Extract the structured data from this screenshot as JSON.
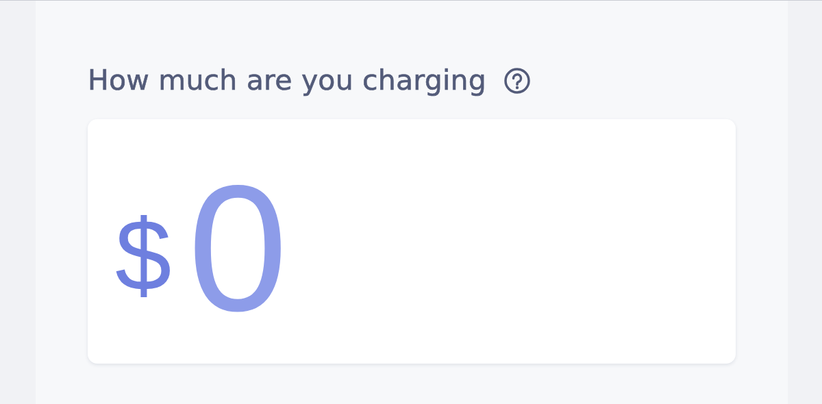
{
  "question": {
    "label": "How much are you charging"
  },
  "amount": {
    "currency": "$",
    "placeholder": "0"
  }
}
